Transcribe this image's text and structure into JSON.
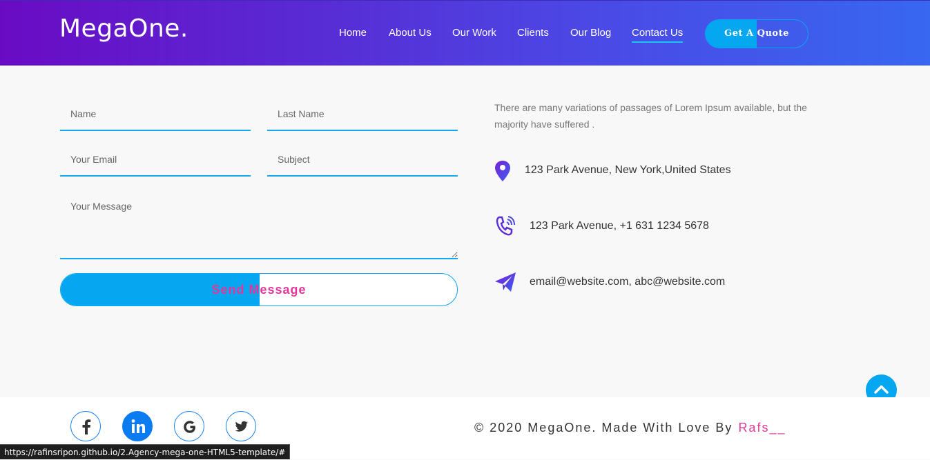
{
  "header": {
    "logo": "MegaOne.",
    "nav": [
      "Home",
      "About Us",
      "Our Work",
      "Clients",
      "Our Blog",
      "Contact Us"
    ],
    "active_nav": "Contact Us",
    "quote_label": "Get A Quote"
  },
  "form": {
    "name_placeholder": "Name",
    "last_name_placeholder": "Last Name",
    "email_placeholder": "Your Email",
    "subject_placeholder": "Subject",
    "message_placeholder": "Your Message",
    "send_label": "Send Message"
  },
  "contact": {
    "intro": "There are many variations of passages of Lorem Ipsum available, but the majority have suffered .",
    "address": "123 Park Avenue, New York,United States",
    "phone": "123 Park Avenue, +1 631 1234 5678",
    "email": "email@website.com, abc@website.com",
    "icons": [
      "map-pin-icon",
      "phone-icon",
      "paper-plane-icon"
    ]
  },
  "footer": {
    "social": [
      "facebook-icon",
      "linkedin-icon",
      "google-icon",
      "twitter-icon"
    ],
    "copyright": "© 2020 MegaOne. Made With Love By",
    "author": "Rafs__"
  },
  "status_bar": {
    "url": "https://rafinsripon.github.io/2.Agency-mega-one-HTML5-template/#"
  },
  "colors": {
    "accent": "#05a7f0",
    "pink": "#e0389a",
    "header_start": "#6a0bc4",
    "header_end": "#3867f0"
  }
}
